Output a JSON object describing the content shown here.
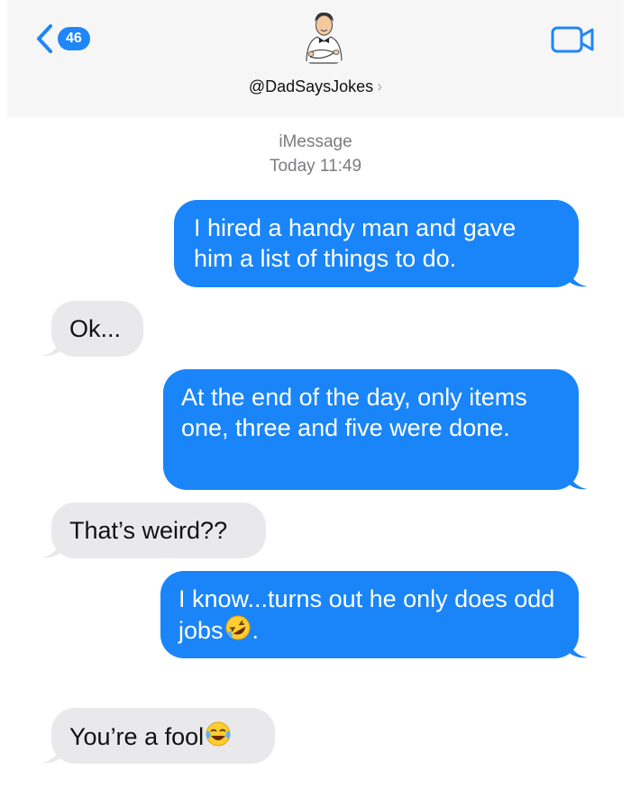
{
  "header": {
    "back_count": "46",
    "contact_name": "@DadSaysJokes",
    "chevron": "›",
    "icons": {
      "back": "chevron-left-icon",
      "video": "video-camera-icon"
    },
    "accent": "#1f86f8"
  },
  "meta": {
    "service": "iMessage",
    "timestamp": "Today 11:49"
  },
  "messages": [
    {
      "direction": "sent",
      "text": "I hired a handy man and gave him a list of things to do."
    },
    {
      "direction": "received",
      "text": "Ok..."
    },
    {
      "direction": "sent",
      "text": "At the end of the day, only items one, three and five were done."
    },
    {
      "direction": "received",
      "text": "That’s weird??"
    },
    {
      "direction": "sent",
      "text": "I know...turns out he only does odd jobs",
      "emoji": "rolling-on-floor-laughing-emoji",
      "suffix": "."
    },
    {
      "direction": "received",
      "text": "You’re a fool",
      "emoji": "face-with-tears-of-joy-emoji"
    }
  ],
  "colors": {
    "sent_bubble": "#1a85f8",
    "received_bubble": "#e9e9eb",
    "header_bg": "#f6f6f6"
  }
}
